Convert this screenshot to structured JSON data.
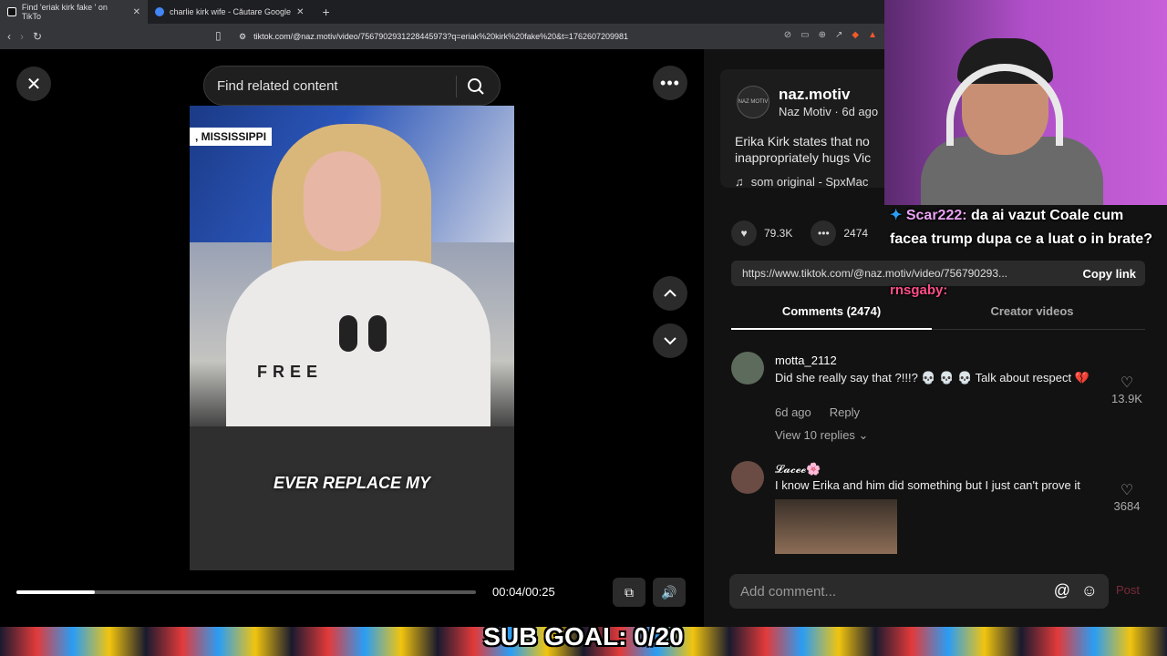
{
  "browser": {
    "tabs": [
      {
        "label": "Find 'eriak kirk fake ' on TikTo"
      },
      {
        "label": "charlie kirk wife - Căutare Google"
      }
    ],
    "url": "tiktok.com/@naz.motiv/video/7567902931228445973?q=eriak%20kirk%20fake%20&t=1762607209981"
  },
  "video": {
    "search_placeholder": "Find related content",
    "location_label": ", MISSISSIPPI",
    "shirt_text": "FREE",
    "caption": "EVER REPLACE MY",
    "time": "00:04/00:25",
    "progress": 0.17
  },
  "author": {
    "avatar_text": "NAZ MOTIV",
    "username": "naz.motiv",
    "sub": "Naz Motiv · 6d ago",
    "description": "Erika Kirk states that no inappropriately hugs Vic",
    "sound": "som original - SpxMac",
    "likes": "79.3K",
    "comments_count": "2474",
    "link": "https://www.tiktok.com/@naz.motiv/video/756790293...",
    "copy_label": "Copy link"
  },
  "tabs": {
    "comments": "Comments (2474)",
    "creator": "Creator videos"
  },
  "comments": [
    {
      "user": "motta_2112",
      "text": "Did she really say that ?!!!? 💀 💀 💀 Talk about respect 💔",
      "meta_time": "6d ago",
      "reply": "Reply",
      "likes": "13.9K",
      "view_replies": "View 10 replies ⌄"
    },
    {
      "user": "𝓛𝓪𝓬𝓮𝓮🌸",
      "text": "I know Erika and him did something but I just can't prove it",
      "likes": "3684"
    }
  ],
  "comment_bar": {
    "placeholder": "Add comment...",
    "post": "Post"
  },
  "overlay": {
    "chat_user": "Scar222:",
    "chat_msg": " da ai vazut Coale cum facea trump dupa ce a luat o in brate?",
    "chat_user2": "rnsgaby:",
    "sub_goal": "SUB GOAL: 0/20"
  }
}
